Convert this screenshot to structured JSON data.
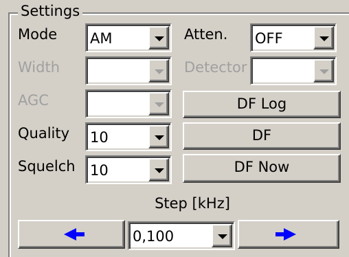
{
  "group": {
    "title": "Settings"
  },
  "rows": {
    "mode": {
      "label": "Mode",
      "value": "AM"
    },
    "width": {
      "label": "Width",
      "value": ""
    },
    "agc": {
      "label": "AGC",
      "value": ""
    },
    "quality": {
      "label": "Quality",
      "value": "10"
    },
    "squelch": {
      "label": "Squelch",
      "value": "10"
    },
    "atten": {
      "label": "Atten.",
      "value": "OFF"
    },
    "detector": {
      "label": "Detector",
      "value": ""
    }
  },
  "buttons": {
    "df_log": "DF Log",
    "df": "DF",
    "df_now": "DF Now"
  },
  "step": {
    "label": "Step [kHz]",
    "value": "0,100",
    "prev_icon": "left-arrow-icon",
    "next_icon": "right-arrow-icon"
  },
  "colors": {
    "face": "#d4d0c8",
    "arrow": "#0000ff",
    "disabled_text": "#a0a0a0"
  }
}
